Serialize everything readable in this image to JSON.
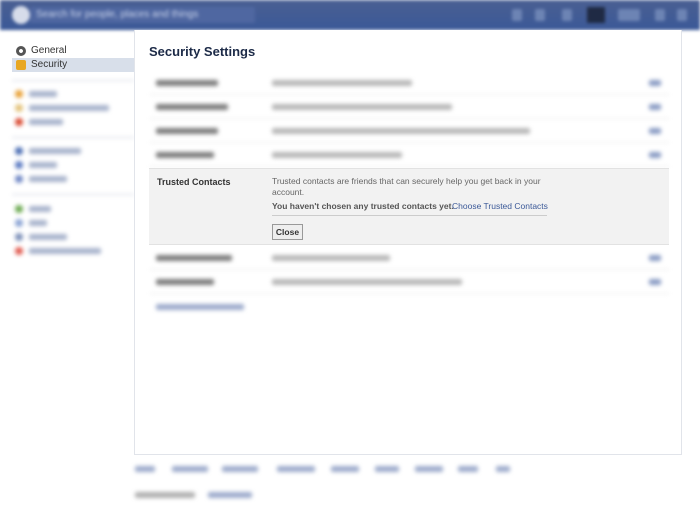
{
  "topbar": {
    "search_placeholder": "Search for people, places and things"
  },
  "sidebar": {
    "items": [
      {
        "label": "General"
      },
      {
        "label": "Security"
      }
    ]
  },
  "main": {
    "title": "Security Settings",
    "trusted_contacts": {
      "label": "Trusted Contacts",
      "description": "Trusted contacts are friends that can securely help you get back in your account.",
      "status": "You haven't chosen any trusted contacts yet.",
      "choose_link": "Choose Trusted Contacts",
      "close_button": "Close"
    }
  },
  "colors": {
    "brand": "#3b5998",
    "panel_bg": "#f2f2f2"
  },
  "icons": [
    "gear-icon",
    "lock-icon"
  ]
}
